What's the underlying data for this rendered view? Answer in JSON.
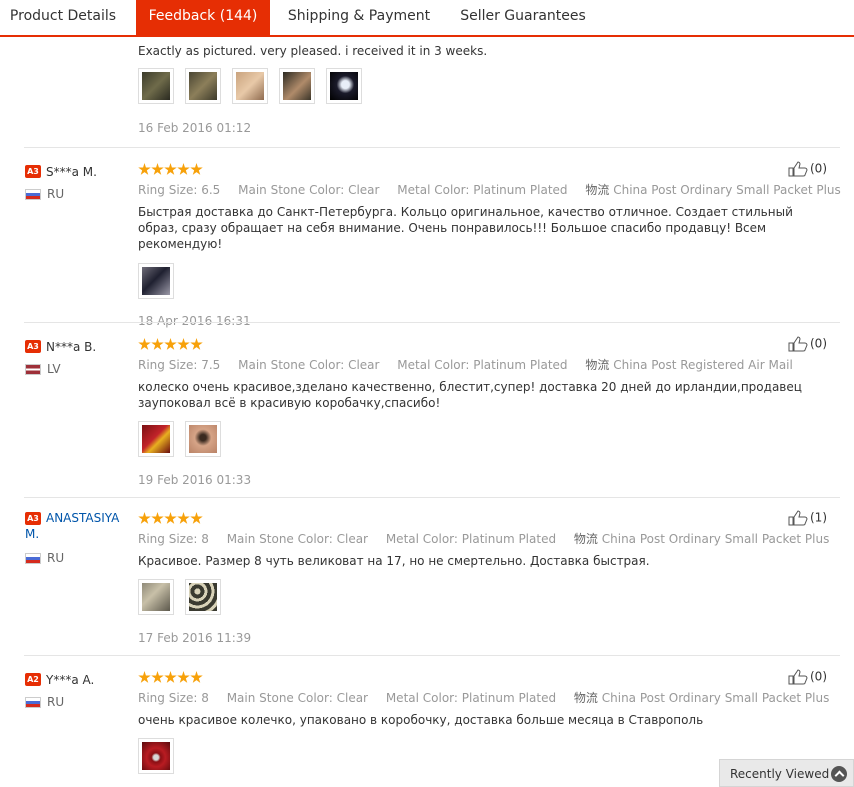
{
  "tabs": [
    {
      "label": "Product Details"
    },
    {
      "label": "Feedback (144)"
    },
    {
      "label": "Shipping & Payment"
    },
    {
      "label": "Seller Guarantees"
    }
  ],
  "labels": {
    "ring_size": "Ring Size:",
    "stone_color": "Main Stone Color:",
    "metal_color": "Metal Color:",
    "logistics": "物流"
  },
  "reviews": [
    {
      "text": "Exactly as pictured. very pleased. i received it in 3 weeks.",
      "date": "16 Feb 2016 01:12"
    },
    {
      "level": "A3",
      "user": "S***a M.",
      "country": "RU",
      "rating": 5,
      "ring_size": "6.5",
      "stone_color": "Clear",
      "metal_color": "Platinum Plated",
      "shipping": "China Post Ordinary Small Packet Plus",
      "text": "Быстрая доставка до Санкт-Петербурга. Кольцо оригинальное, качество отличное. Создает стильный образ, сразу обращает на себя внимание. Очень понравилось!!! Большое спасибо продавцу! Всем рекомендую!",
      "date": "18 Apr 2016 16:31",
      "helpful": "(0)"
    },
    {
      "level": "A3",
      "user": "N***a B.",
      "country": "LV",
      "rating": 5,
      "ring_size": "7.5",
      "stone_color": "Clear",
      "metal_color": "Platinum Plated",
      "shipping": "China Post Registered Air Mail",
      "text": "колеско очень красивое,зделано качественно, блестит,супер! доставка 20 дней до ирландии,продавец заупоковал всё в красивую коробачку,спасибо!",
      "date": "19 Feb 2016 01:33",
      "helpful": "(0)"
    },
    {
      "level": "A3",
      "user": "ANASTASIYA M.",
      "country": "RU",
      "rating": 5,
      "ring_size": "8",
      "stone_color": "Clear",
      "metal_color": "Platinum Plated",
      "shipping": "China Post Ordinary Small Packet Plus",
      "text": "Красивое. Размер 8 чуть великоват на 17, но не смертельно. Доставка быстрая.",
      "date": "17 Feb 2016 11:39",
      "helpful": "(1)"
    },
    {
      "level": "A2",
      "user": "Y***a A.",
      "country": "RU",
      "rating": 5,
      "ring_size": "8",
      "stone_color": "Clear",
      "metal_color": "Platinum Plated",
      "shipping": "China Post Ordinary Small Packet Plus",
      "text": "очень красивое колечко, упаковано в коробочку, доставка больше месяца в Ставрополь",
      "helpful": "(0)"
    }
  ],
  "recently_viewed": "Recently Viewed",
  "colors": {
    "accent": "#e62e04",
    "star": "#f7a10a",
    "link": "#0055aa"
  }
}
